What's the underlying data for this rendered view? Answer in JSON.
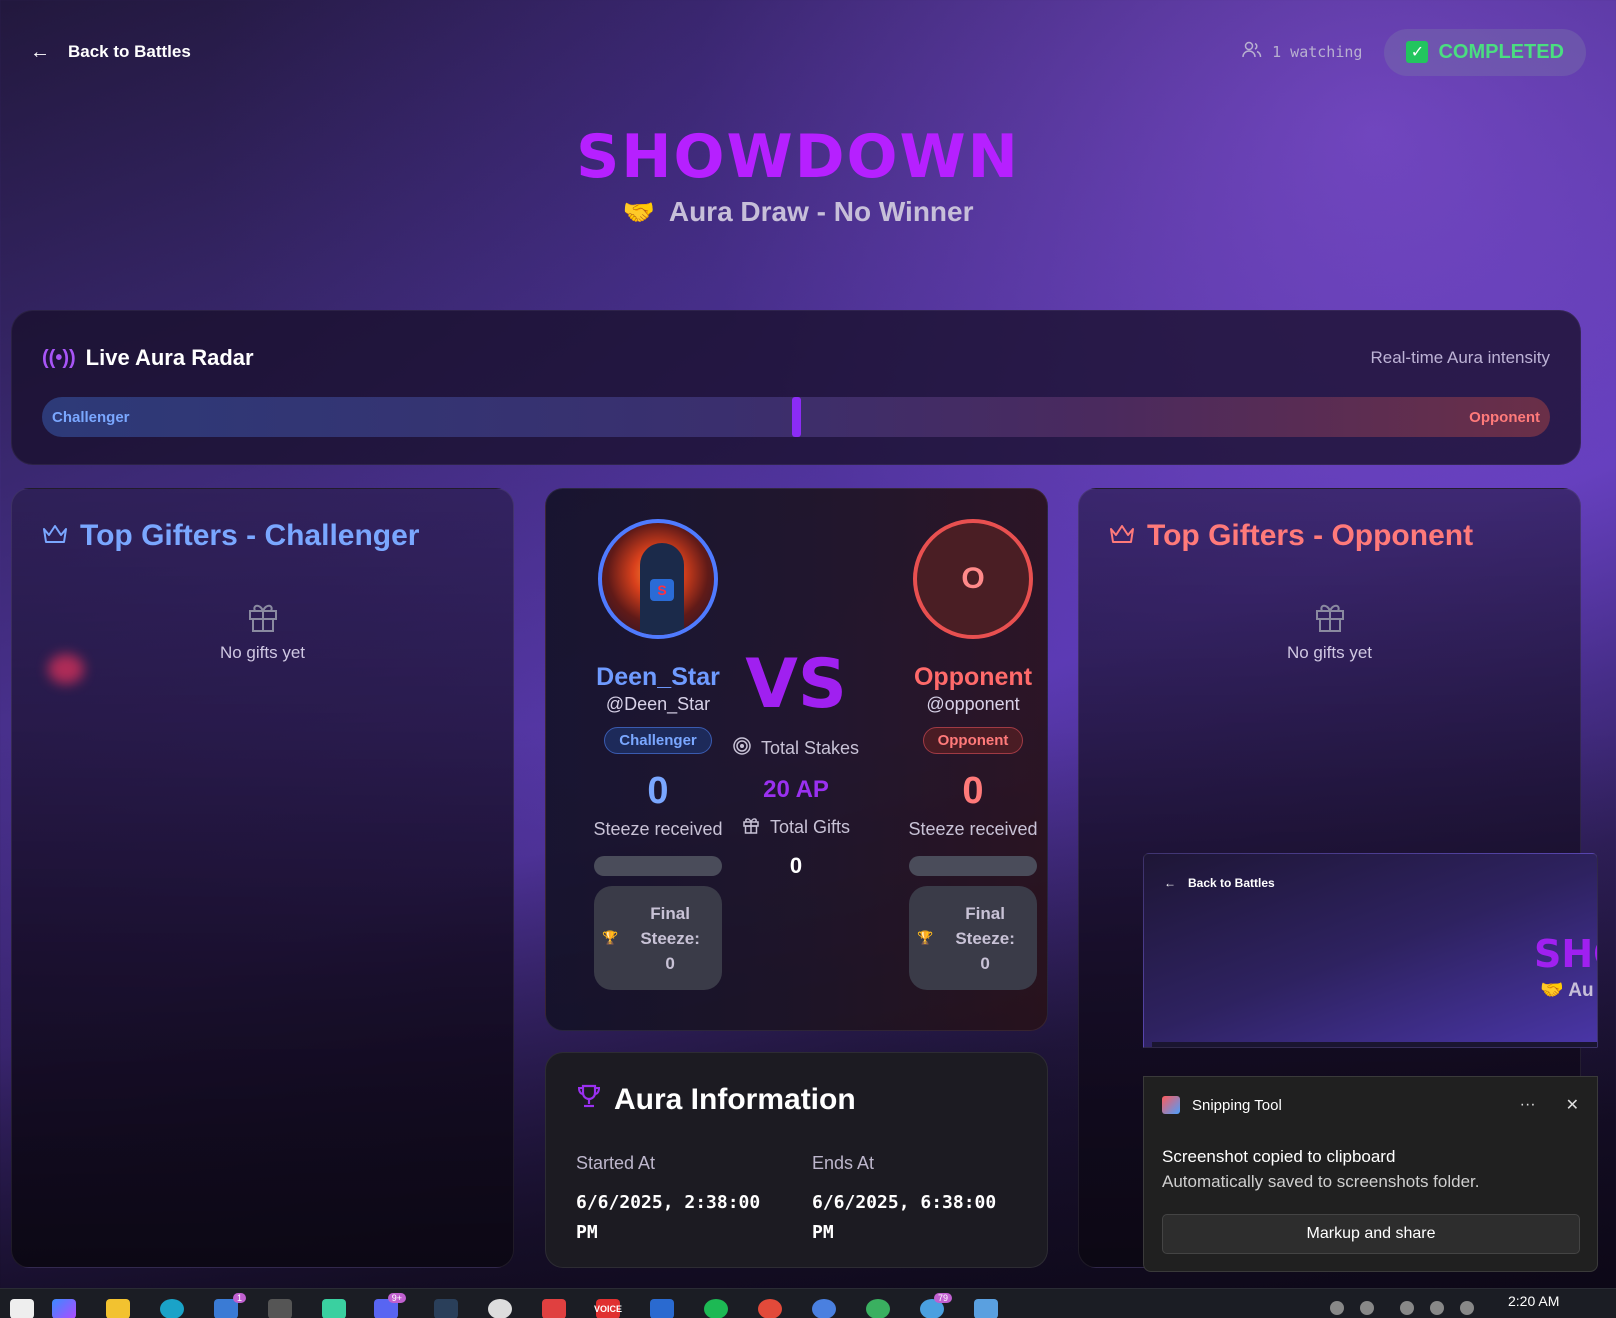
{
  "nav": {
    "back_label": "Back to Battles"
  },
  "status": {
    "watching": "1 watching",
    "completed": "COMPLETED"
  },
  "hero": {
    "title": "SHOWDOWN",
    "emoji": "🤝",
    "subtitle": "Aura Draw - No Winner"
  },
  "radar": {
    "title": "Live Aura Radar",
    "subtitle": "Real-time Aura intensity",
    "left_label": "Challenger",
    "right_label": "Opponent",
    "position": 0.5
  },
  "gifters_left": {
    "title": "Top Gifters - Challenger",
    "empty": "No gifts yet"
  },
  "gifters_right": {
    "title": "Top Gifters - Opponent",
    "empty": "No gifts yet"
  },
  "battle": {
    "challenger": {
      "name": "Deen_Star",
      "handle": "@Deen_Star",
      "role": "Challenger",
      "score": "0",
      "steeze_label": "Steeze received",
      "final_label": "Final Steeze:",
      "final_value": "0"
    },
    "opponent": {
      "initial": "O",
      "name": "Opponent",
      "handle": "@opponent",
      "role": "Opponent",
      "score": "0",
      "steeze_label": "Steeze received",
      "final_label": "Final Steeze:",
      "final_value": "0"
    },
    "vs": "VS",
    "stakes_label": "Total Stakes",
    "stakes_value": "20 AP",
    "gifts_label": "Total Gifts",
    "gifts_value": "0"
  },
  "aura_info": {
    "title": "Aura Information",
    "started_label": "Started At",
    "started_value": "6/6/2025, 2:38:00 PM",
    "ends_label": "Ends At",
    "ends_value": "6/6/2025, 6:38:00 PM"
  },
  "preview": {
    "back_label": "Back to Battles",
    "title": "SHO",
    "subtitle": "Au"
  },
  "toast": {
    "app": "Snipping Tool",
    "more": "···",
    "close": "✕",
    "message": "Screenshot copied to clipboard",
    "detail": "Automatically saved to screenshots folder.",
    "button": "Markup and share"
  },
  "taskbar": {
    "clock": "2:20 AM",
    "badge_1": "1",
    "badge_2": "9+",
    "badge_3": "79",
    "voice": "VOICE"
  },
  "colors": {
    "accent": "#a020f0",
    "challenger": "#7aa7ff",
    "opponent": "#ff7a7a",
    "success": "#4ade80"
  }
}
